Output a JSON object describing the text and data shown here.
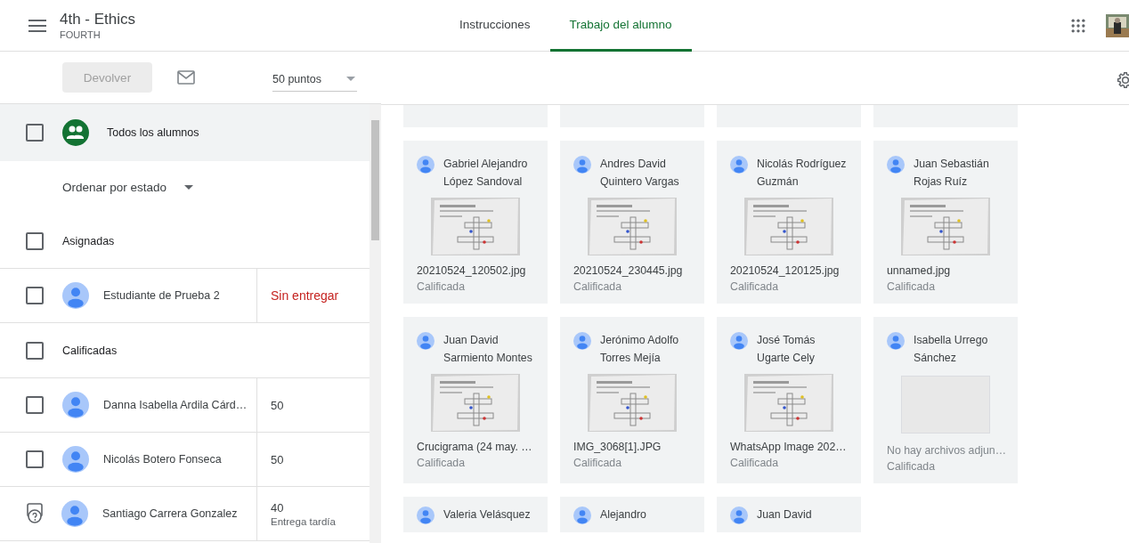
{
  "header": {
    "class_title": "4th - Ethics",
    "class_section": "FOURTH",
    "tabs": [
      {
        "label": "Instrucciones",
        "selected": false
      },
      {
        "label": "Trabajo del alumno",
        "selected": true
      }
    ]
  },
  "toolbar": {
    "return_button": {
      "label": "Devolver",
      "disabled": true
    },
    "points": "50 puntos"
  },
  "roster": {
    "all": {
      "label": "Todos los alumnos",
      "checked": false
    },
    "sort": "Ordenar por estado",
    "groups": [
      {
        "label": "Asignadas",
        "checked": false,
        "students": [
          {
            "name": "Estudiante de Prueba 2",
            "grade": "Sin entregar",
            "kind": "missing",
            "checked": false
          }
        ]
      },
      {
        "label": "Calificadas",
        "checked": false,
        "students": [
          {
            "name": "Danna Isabella Ardila Cárd…",
            "grade": "50",
            "kind": "graded",
            "checked": false
          },
          {
            "name": "Nicolás Botero Fonseca",
            "grade": "50",
            "kind": "graded",
            "checked": false
          },
          {
            "name": "Santiago Carrera Gonzalez",
            "grade": "40",
            "note": "Entrega tardía",
            "kind": "late"
          }
        ]
      }
    ]
  },
  "cards": [
    {
      "kind": "stub"
    },
    {
      "kind": "stub"
    },
    {
      "kind": "stub"
    },
    {
      "kind": "stub"
    },
    {
      "kind": "picture",
      "name": "Gabriel Alejandro López Sandoval",
      "file": "20210524_120502.jpg",
      "status": "Calificada"
    },
    {
      "kind": "picture",
      "name": "Andres David Quintero Vargas",
      "file": "20210524_230445.jpg",
      "status": "Calificada"
    },
    {
      "kind": "picture",
      "name": "Nicolás Rodríguez Guzmán",
      "file": "20210524_120125.jpg",
      "status": "Calificada"
    },
    {
      "kind": "picture",
      "name": "Juan Sebastián Rojas Ruíz",
      "file": "unnamed.jpg",
      "status": "Calificada"
    },
    {
      "kind": "picture",
      "name": "Juan David Sarmiento Montes",
      "file": "Crucigrama (24 may. …",
      "status": "Calificada"
    },
    {
      "kind": "picture",
      "name": "Jerónimo Adolfo Torres Mejía",
      "file": "IMG_3068[1].JPG",
      "status": "Calificada"
    },
    {
      "kind": "picture",
      "name": "José Tomás Ugarte Cely",
      "file": "WhatsApp Image 202…",
      "status": "Calificada"
    },
    {
      "kind": "empty",
      "name": "Isabella Urrego Sánchez",
      "file": "No hay archivos adjun…",
      "status": "Calificada"
    },
    {
      "kind": "partial",
      "name": "Valeria Velásquez"
    },
    {
      "kind": "partial",
      "name": "Alejandro"
    },
    {
      "kind": "partial",
      "name": "Juan David"
    }
  ]
}
